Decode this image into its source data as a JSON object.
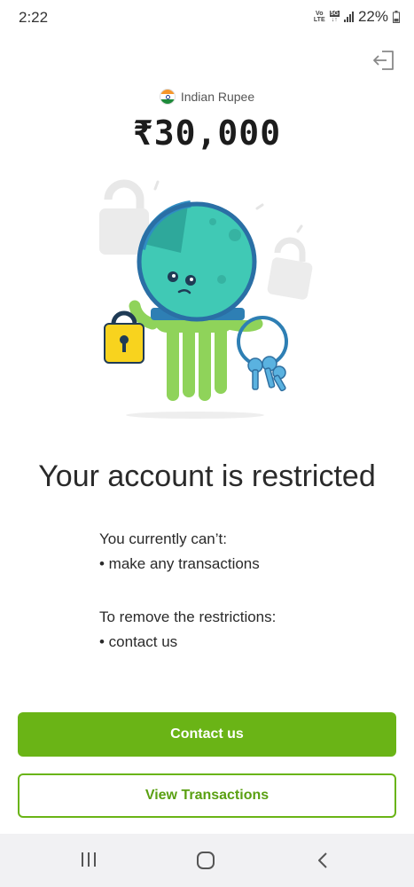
{
  "status_bar": {
    "time": "2:22",
    "network_top": "VoLTE",
    "network_5g": "5G",
    "battery": "22%"
  },
  "header": {
    "currency_name": "Indian Rupee",
    "amount": "₹30,000"
  },
  "illustration": {
    "description_icon": "restricted-astronaut-octopus-with-lock-and-keys-icon"
  },
  "main": {
    "headline": "Your account is restricted",
    "cant_title": "You currently can’t:",
    "cant_items": [
      "• make any transactions"
    ],
    "remove_title": "To remove the restrictions:",
    "remove_items": [
      "• contact us"
    ]
  },
  "actions": {
    "primary_label": "Contact us",
    "secondary_label": "View Transactions"
  },
  "colors": {
    "brand_green": "#6ab416",
    "teal": "#3ec9b8",
    "lock_yellow": "#f8d31e"
  }
}
